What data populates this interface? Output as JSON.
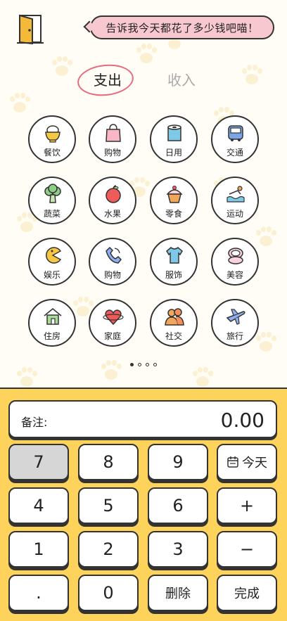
{
  "header": {
    "prompt": "告诉我今天都花了多少钱吧喵！"
  },
  "tabs": {
    "expense": "支出",
    "income": "收入"
  },
  "categories": [
    {
      "label": "餐饮",
      "icon": "rice-bowl-icon"
    },
    {
      "label": "购物",
      "icon": "shopping-bag-icon"
    },
    {
      "label": "日用",
      "icon": "toilet-paper-icon"
    },
    {
      "label": "交通",
      "icon": "bus-icon"
    },
    {
      "label": "蔬菜",
      "icon": "broccoli-icon"
    },
    {
      "label": "水果",
      "icon": "apple-icon"
    },
    {
      "label": "零食",
      "icon": "cupcake-icon"
    },
    {
      "label": "运动",
      "icon": "swim-icon"
    },
    {
      "label": "娱乐",
      "icon": "pacman-icon"
    },
    {
      "label": "购物",
      "icon": "phone-icon"
    },
    {
      "label": "服饰",
      "icon": "tshirt-icon"
    },
    {
      "label": "美容",
      "icon": "compact-mirror-icon"
    },
    {
      "label": "住房",
      "icon": "house-icon"
    },
    {
      "label": "家庭",
      "icon": "heart-planet-icon"
    },
    {
      "label": "社交",
      "icon": "people-icon"
    },
    {
      "label": "旅行",
      "icon": "airplane-icon"
    }
  ],
  "pager": {
    "count": 4,
    "active": 0
  },
  "keypad": {
    "note_label": "备注:",
    "amount": "0.00",
    "keys": {
      "k7": "7",
      "k8": "8",
      "k9": "9",
      "today": "今天",
      "k4": "4",
      "k5": "5",
      "k6": "6",
      "plus": "+",
      "k1": "1",
      "k2": "2",
      "k3": "3",
      "minus": "−",
      "dot": ".",
      "k0": "0",
      "delete": "删除",
      "done": "完成"
    }
  },
  "colors": {
    "accent_yellow": "#fdd35c",
    "bubble_pink": "#f7c8cf",
    "tab_underline": "#e86b7d"
  }
}
